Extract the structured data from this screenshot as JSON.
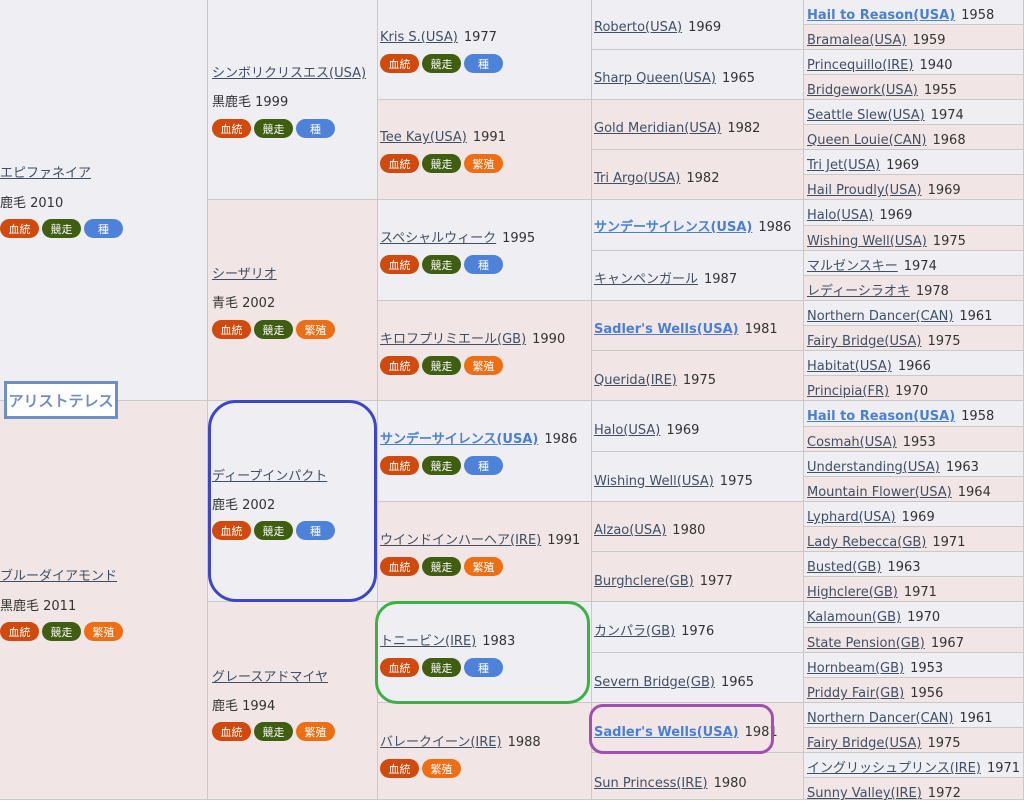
{
  "badge_labels": {
    "bloodline": "血統",
    "racing": "競走",
    "stallion": "種",
    "breeding": "繁殖"
  },
  "colors": {
    "bloodline": "#d04a0e",
    "racing": "#3f5e12",
    "stallion": "#4e82d8",
    "breeding": "#ee6f13",
    "highlight_blue": "#3b47c8",
    "highlight_green": "#3db045",
    "highlight_purple": "#a14fb0"
  },
  "subject": {
    "name": "アリストテレス"
  },
  "gen1": [
    {
      "name": "エピファネイア",
      "detail": "鹿毛 2010"
    },
    {
      "name": "ブルーダイアモンド",
      "detail": "黒鹿毛 2011"
    }
  ],
  "gen2": [
    {
      "name": "シンボリクリスエス(USA)",
      "detail": "黒鹿毛 1999"
    },
    {
      "name": "シーザリオ",
      "detail": "青毛 2002"
    },
    {
      "name": "ディープインパクト",
      "detail": "鹿毛 2002"
    },
    {
      "name": "グレースアドマイヤ",
      "detail": "鹿毛 1994"
    }
  ],
  "gen3": [
    {
      "name": "Kris S.(USA)",
      "year": "1977"
    },
    {
      "name": "Tee Kay(USA)",
      "year": "1991"
    },
    {
      "name": "スペシャルウィーク",
      "year": "1995"
    },
    {
      "name": "キロフプリミエール(GB)",
      "year": "1990"
    },
    {
      "name": "サンデーサイレンス(USA)",
      "year": "1986"
    },
    {
      "name": "ウインドインハーヘア(IRE)",
      "year": "1991"
    },
    {
      "name": "トニービン(IRE)",
      "year": "1983"
    },
    {
      "name": "バレークイーン(IRE)",
      "year": "1988"
    }
  ],
  "gen4": [
    {
      "name": "Roberto(USA)",
      "year": "1969"
    },
    {
      "name": "Sharp Queen(USA)",
      "year": "1965"
    },
    {
      "name": "Gold Meridian(USA)",
      "year": "1982"
    },
    {
      "name": "Tri Argo(USA)",
      "year": "1982"
    },
    {
      "name": "サンデーサイレンス(USA)",
      "year": "1986"
    },
    {
      "name": "キャンペンガール",
      "year": "1987"
    },
    {
      "name": "Sadler's Wells(USA)",
      "year": "1981"
    },
    {
      "name": "Querida(IRE)",
      "year": "1975"
    },
    {
      "name": "Halo(USA)",
      "year": "1969"
    },
    {
      "name": "Wishing Well(USA)",
      "year": "1975"
    },
    {
      "name": "Alzao(USA)",
      "year": "1980"
    },
    {
      "name": "Burghclere(GB)",
      "year": "1977"
    },
    {
      "name": "カンパラ(GB)",
      "year": "1976"
    },
    {
      "name": "Severn Bridge(GB)",
      "year": "1965"
    },
    {
      "name": "Sadler's Wells(USA)",
      "year": "1981"
    },
    {
      "name": "Sun Princess(IRE)",
      "year": "1980"
    }
  ],
  "gen5": [
    {
      "name": "Hail to Reason(USA)",
      "year": "1958"
    },
    {
      "name": "Bramalea(USA)",
      "year": "1959"
    },
    {
      "name": "Princequillo(IRE)",
      "year": "1940"
    },
    {
      "name": "Bridgework(USA)",
      "year": "1955"
    },
    {
      "name": "Seattle Slew(USA)",
      "year": "1974"
    },
    {
      "name": "Queen Louie(CAN)",
      "year": "1968"
    },
    {
      "name": "Tri Jet(USA)",
      "year": "1969"
    },
    {
      "name": "Hail Proudly(USA)",
      "year": "1969"
    },
    {
      "name": "Halo(USA)",
      "year": "1969"
    },
    {
      "name": "Wishing Well(USA)",
      "year": "1975"
    },
    {
      "name": "マルゼンスキー",
      "year": "1974"
    },
    {
      "name": "レディーシラオキ",
      "year": "1978"
    },
    {
      "name": "Northern Dancer(CAN)",
      "year": "1961"
    },
    {
      "name": "Fairy Bridge(USA)",
      "year": "1975"
    },
    {
      "name": "Habitat(USA)",
      "year": "1966"
    },
    {
      "name": "Principia(FR)",
      "year": "1970"
    },
    {
      "name": "Hail to Reason(USA)",
      "year": "1958"
    },
    {
      "name": "Cosmah(USA)",
      "year": "1953"
    },
    {
      "name": "Understanding(USA)",
      "year": "1963"
    },
    {
      "name": "Mountain Flower(USA)",
      "year": "1964"
    },
    {
      "name": "Lyphard(USA)",
      "year": "1969"
    },
    {
      "name": "Lady Rebecca(GB)",
      "year": "1971"
    },
    {
      "name": "Busted(GB)",
      "year": "1963"
    },
    {
      "name": "Highclere(GB)",
      "year": "1971"
    },
    {
      "name": "Kalamoun(GB)",
      "year": "1970"
    },
    {
      "name": "State Pension(GB)",
      "year": "1967"
    },
    {
      "name": "Hornbeam(GB)",
      "year": "1953"
    },
    {
      "name": "Priddy Fair(GB)",
      "year": "1956"
    },
    {
      "name": "Northern Dancer(CAN)",
      "year": "1961"
    },
    {
      "name": "Fairy Bridge(USA)",
      "year": "1975"
    },
    {
      "name": "イングリッシュプリンス(IRE)",
      "year": "1971"
    },
    {
      "name": "Sunny Valley(IRE)",
      "year": "1972"
    }
  ]
}
